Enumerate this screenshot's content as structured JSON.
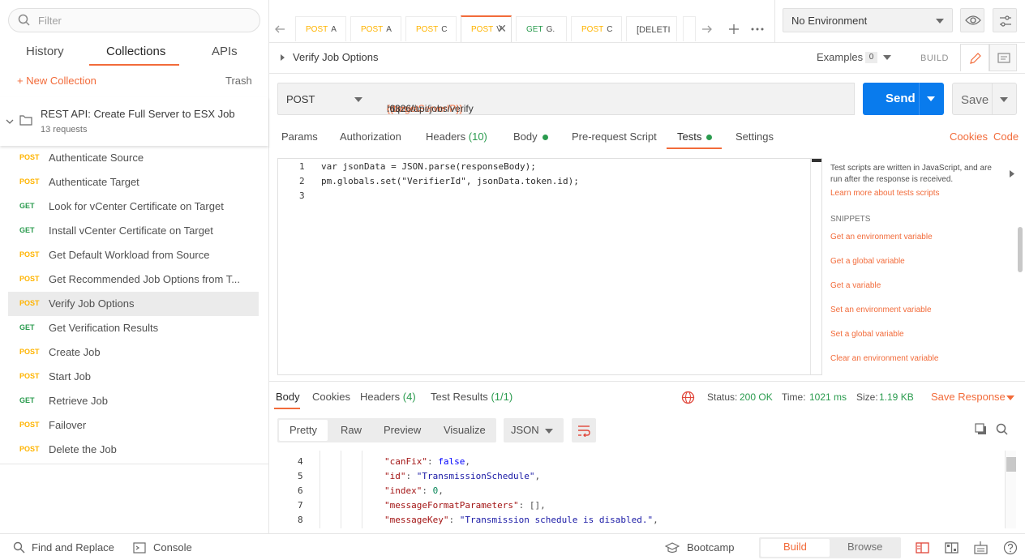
{
  "sidebar": {
    "filter_placeholder": "Filter",
    "tabs": [
      "History",
      "Collections",
      "APIs"
    ],
    "new_collection": "+ New Collection",
    "trash": "Trash",
    "collection": {
      "name": "REST API: Create Full Server to ESX Job",
      "count": "13 requests"
    },
    "requests": [
      {
        "method": "POST",
        "name": "Authenticate Source"
      },
      {
        "method": "POST",
        "name": "Authenticate Target"
      },
      {
        "method": "GET",
        "name": "Look for vCenter Certificate on Target"
      },
      {
        "method": "GET",
        "name": "Install vCenter Certificate on Target"
      },
      {
        "method": "POST",
        "name": "Get Default Workload from Source"
      },
      {
        "method": "POST",
        "name": "Get Recommended Job Options from T..."
      },
      {
        "method": "POST",
        "name": "Verify Job Options"
      },
      {
        "method": "GET",
        "name": "Get Verification Results"
      },
      {
        "method": "POST",
        "name": "Create Job"
      },
      {
        "method": "POST",
        "name": "Start Job"
      },
      {
        "method": "GET",
        "name": "Retrieve Job"
      },
      {
        "method": "POST",
        "name": "Failover"
      },
      {
        "method": "POST",
        "name": "Delete the Job"
      }
    ]
  },
  "tabs": [
    {
      "method": "POST",
      "name": "A"
    },
    {
      "method": "POST",
      "name": "A"
    },
    {
      "method": "POST",
      "name": "C"
    },
    {
      "method": "POST",
      "name": "V"
    },
    {
      "method": "GET",
      "name": "G."
    },
    {
      "method": "POST",
      "name": "C"
    },
    {
      "method": "",
      "name": "[DELETI"
    }
  ],
  "environment": "No Environment",
  "request": {
    "name": "Verify Job Options",
    "examples_label": "Examples",
    "examples_count": "0",
    "build_label": "BUILD",
    "method": "POST",
    "url_prefix": "https://",
    "url_var": "{{targetServerIP}}",
    "url_suffix": ":6326/api/jobs/verify",
    "send": "Send",
    "save": "Save",
    "subtabs": [
      "Params",
      "Authorization",
      "Headers",
      "(10)",
      "Body",
      "Pre-request Script",
      "Tests",
      "Settings"
    ],
    "cookies": "Cookies",
    "code": "Code"
  },
  "editor": {
    "lines": [
      "1",
      "2",
      "3"
    ],
    "code": [
      "var jsonData = JSON.parse(responseBody);",
      "pm.globals.set(\"VerifierId\", jsonData.token.id);",
      ""
    ]
  },
  "snippets": {
    "intro": "Test scripts are written in JavaScript, and are run after the response is received.",
    "learn_more": "Learn more about tests scripts",
    "heading": "SNIPPETS",
    "items": [
      "Get an environment variable",
      "Get a global variable",
      "Get a variable",
      "Set an environment variable",
      "Set a global variable",
      "Clear an environment variable"
    ]
  },
  "response": {
    "tabs": [
      "Body",
      "Cookies",
      "Headers",
      "(4)",
      "Test Results",
      "(1/1)"
    ],
    "status_label": "Status:",
    "status": "200 OK",
    "time_label": "Time:",
    "time": "1021 ms",
    "size_label": "Size:",
    "size": "1.19 KB",
    "save_response": "Save Response",
    "formats": [
      "Pretty",
      "Raw",
      "Preview",
      "Visualize"
    ],
    "lang": "JSON",
    "lines": [
      "4",
      "5",
      "6",
      "7",
      "8"
    ],
    "keys": [
      "\"canFix\"",
      "\"id\"",
      "\"index\"",
      "\"messageFormatParameters\"",
      "\"messageKey\""
    ],
    "values": [
      "false",
      "\"TransmissionSchedule\"",
      "0",
      "[]",
      "\"Transmission schedule is disabled.\""
    ],
    "suffix": [
      ",",
      ",",
      ",",
      ",",
      ","
    ]
  },
  "footer": {
    "find_replace": "Find and Replace",
    "console": "Console",
    "bootcamp": "Bootcamp",
    "build": "Build",
    "browse": "Browse"
  },
  "colors": {
    "accent": "#f26b3a",
    "send": "#097bed",
    "post": "#ffb400",
    "get": "#2a9b4e"
  }
}
